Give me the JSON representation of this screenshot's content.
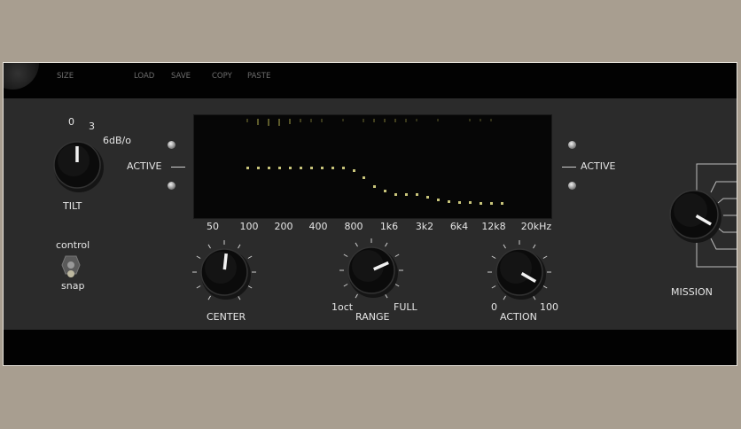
{
  "menu": {
    "size": "SIZE",
    "load": "LOAD",
    "save": "SAVE",
    "copy": "COPY",
    "paste": "PASTE"
  },
  "tilt": {
    "label": "TILT",
    "scale": [
      "0",
      "3",
      "6dB/o"
    ],
    "value": 0.5
  },
  "switch": {
    "top_label": "control",
    "bottom_label": "snap",
    "state": "snap"
  },
  "active_left": "ACTIVE",
  "active_right": "ACTIVE",
  "display": {
    "freq_labels": [
      "50",
      "100",
      "200",
      "400",
      "800",
      "1k6",
      "3k2",
      "6k4",
      "12k8",
      "20kHz"
    ],
    "curve_db": [
      0,
      0,
      0,
      0,
      0,
      0,
      0,
      0,
      0,
      0,
      -0.5,
      -1.6,
      -3.2,
      -4.0,
      -4.5,
      -4.5,
      -4.5,
      -5.0,
      -5.4,
      -5.8,
      -5.9,
      -5.9,
      -6.0,
      -6.0,
      -6.0
    ],
    "meter_levels": [
      0.3,
      0.6,
      0.7,
      0.7,
      0.5,
      0.3,
      0.2,
      0.2,
      0,
      0.1,
      0,
      0.2,
      0.3,
      0.3,
      0.3,
      0.2,
      0.1,
      0,
      0.1,
      0,
      0,
      0.1,
      0.1,
      0.1,
      0
    ]
  },
  "center": {
    "label": "CENTER",
    "value": 0.52
  },
  "range": {
    "label": "RANGE",
    "min": "1oct",
    "max": "FULL",
    "value": 0.72
  },
  "action": {
    "label": "ACTION",
    "min": "0",
    "max": "100",
    "value": 0.9
  },
  "mission": {
    "label": "MISSION",
    "value": 0.9
  }
}
